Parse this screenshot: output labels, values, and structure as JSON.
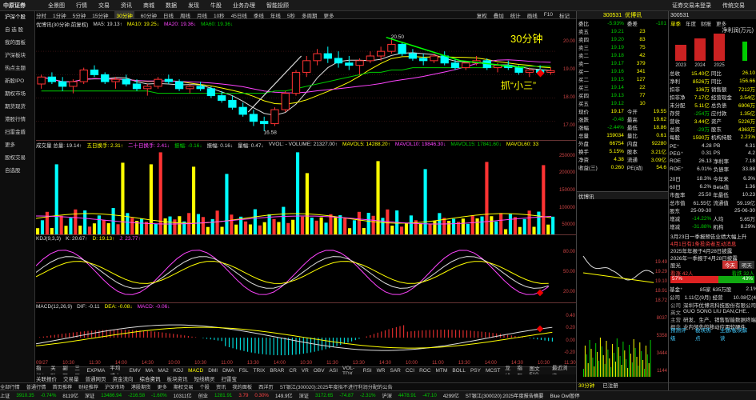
{
  "app": {
    "logo": "中原证券",
    "menu": [
      "全景图",
      "行情",
      "交易",
      "资讯",
      "商城",
      "数据",
      "发现",
      "牛股",
      "业务办理",
      "智能投顾"
    ],
    "right_menu": [
      "证券交易未登录",
      "传统交易"
    ]
  },
  "sidebar": [
    {
      "label": "沪深个股"
    },
    {
      "label": "自 选 股"
    },
    {
      "label": "我的面板"
    },
    {
      "label": "沪深板块"
    },
    {
      "label": "热点主题"
    },
    {
      "label": "新股IPO"
    },
    {
      "label": "期权市场"
    },
    {
      "label": "期货现货"
    },
    {
      "label": "港股行情"
    },
    {
      "label": "扫雷金盾"
    },
    {
      "label": "更多"
    },
    {
      "label": "股权交易"
    },
    {
      "label": "自选股"
    }
  ],
  "period_bar": {
    "items": [
      "分时",
      "1分钟",
      "5分钟",
      "15分钟",
      "30分钟",
      "60分钟",
      "日线",
      "周线",
      "月线",
      "10秒",
      "45日线",
      "季线",
      "年线",
      "5秒",
      "多周期",
      "更多"
    ],
    "selected": "30分钟",
    "right": [
      "复权",
      "叠加",
      "统计",
      "画线",
      "F10",
      "标记"
    ]
  },
  "main": {
    "title": "优博讯(30分钟,前复权)",
    "ma": [
      {
        "label": "MA5: 19.13↑",
        "color": "#ddd"
      },
      {
        "label": "MA10: 19.25↓",
        "color": "#ff0"
      },
      {
        "label": "MA20: 19.36↓",
        "color": "#f4f"
      },
      {
        "label": "MA60: 19.36↓",
        "color": "#0c0"
      }
    ],
    "annot1": "30分钟",
    "annot2": "抓“小三”",
    "high_label": "20.50",
    "low_label": "16.58",
    "y_ticks": [
      "20.00",
      "19.00",
      "18.00",
      "17.00"
    ]
  },
  "vol": {
    "legend": [
      {
        "label": "成交量 总量: 19.14↑",
        "color": "#ddd"
      },
      {
        "label": "五日换手: 2.31↑",
        "color": "#ff0"
      },
      {
        "label": "二十日换手: 2.41↓",
        "color": "#f4f"
      },
      {
        "label": "振幅: -0.16↓",
        "color": "#0c0"
      },
      {
        "label": "振幅: 0.16↓",
        "color": "#ddd"
      },
      {
        "label": "量幅: 0.47↓",
        "color": "#ddd"
      },
      {
        "label": "VVOL: - VOLUME: 21327.00↑",
        "color": "#ddd"
      },
      {
        "label": "MAVOL5: 14288.20↑",
        "color": "#ff0"
      },
      {
        "label": "MAVOL10: 19846.30↓",
        "color": "#f4f"
      },
      {
        "label": "MAVOL15: 17841.60↓",
        "color": "#0c0"
      },
      {
        "label": "MAVOL60: 33",
        "color": "#ff0"
      }
    ],
    "y_ticks": [
      "250000",
      "200000",
      "150000",
      "100000",
      "50000"
    ]
  },
  "kdj": {
    "legend": [
      {
        "label": "KDJ(9,3,3)",
        "color": "#ddd"
      },
      {
        "label": "K: 20.67↑",
        "color": "#ddd"
      },
      {
        "label": "D: 19.13↑",
        "color": "#ff0"
      },
      {
        "label": "J: 23.77↑",
        "color": "#f4f"
      }
    ],
    "y_ticks": [
      "80.00",
      "50.00",
      "20.00"
    ]
  },
  "macd": {
    "legend": [
      {
        "label": "MACD(12,26,9)",
        "color": "#ddd"
      },
      {
        "label": "DIF: -0.11",
        "color": "#ddd"
      },
      {
        "label": "DEA: -0.08↓",
        "color": "#ff0"
      },
      {
        "label": "MACD: -0.06↓",
        "color": "#f4f"
      }
    ],
    "y_ticks": [
      "0.40",
      "0.20",
      "0.00",
      "-0.20"
    ]
  },
  "time_axis": [
    "09/27",
    "10:30",
    "11:30",
    "14:00",
    "14:30",
    "10:00",
    "10:30",
    "11:00",
    "13:30",
    "14:00",
    "10:30",
    "11:30",
    "13:30",
    "14:30",
    "10:00",
    "11:00",
    "13:30",
    "14:00",
    "14:30",
    "10:30",
    "11:30"
  ],
  "indicator_bar": {
    "items": [
      "指标A",
      "关联",
      "副图",
      "三画",
      "EXPMA",
      "平均成本",
      "EMV",
      "MA",
      "MA2",
      "KDJ",
      "MACD",
      "DMI",
      "DMA",
      "FSL",
      "TRIX",
      "BRAR",
      "CR",
      "VR",
      "OBV",
      "ASI",
      "VOL-TDX",
      "RSI",
      "WR",
      "SAR",
      "CCI",
      "ROC",
      "MTM",
      "BOLL",
      "PSY",
      "MCST",
      "龙线",
      "指题"
    ],
    "selected": "MACD",
    "right": [
      "图文F10",
      "最近浏览"
    ]
  },
  "quote": {
    "code": "300531",
    "name": "优博讯",
    "webi": {
      "label": "委比",
      "val": "-5.93%",
      "label2": "委差",
      "val2": "-101"
    },
    "sell": [
      {
        "l": "卖五",
        "p": "19.21",
        "v": "23"
      },
      {
        "l": "卖四",
        "p": "19.20",
        "v": "83"
      },
      {
        "l": "卖三",
        "p": "19.19",
        "v": "75"
      },
      {
        "l": "卖二",
        "p": "19.18",
        "v": "42"
      },
      {
        "l": "卖一",
        "p": "19.17",
        "v": "379"
      }
    ],
    "buy": [
      {
        "l": "买一",
        "p": "19.16",
        "v": "341"
      },
      {
        "l": "买二",
        "p": "19.15",
        "v": "127"
      },
      {
        "l": "买三",
        "p": "19.14",
        "v": "22"
      },
      {
        "l": "买四",
        "p": "19.13",
        "v": "77"
      },
      {
        "l": "买五",
        "p": "19.12",
        "v": "10"
      }
    ],
    "stats": [
      [
        "现价",
        "19.17",
        "今开",
        "19.55"
      ],
      [
        "涨跌",
        "-0.48",
        "最高",
        "19.62"
      ],
      [
        "涨幅",
        "-2.44%",
        "最低",
        "18.86"
      ],
      [
        "总量",
        "159034",
        "量比",
        "0.61"
      ],
      [
        "外盘",
        "66754",
        "内盘",
        "92280"
      ],
      [
        "换手",
        "5.15%",
        "股本",
        "3.21亿"
      ],
      [
        "净资",
        "4.38",
        "流通",
        "3.09亿"
      ],
      [
        "收益(三)",
        "0.260",
        "PE(动)",
        "54.6"
      ]
    ]
  },
  "bottom_tabs": [
    "关联报价",
    "交易量",
    "普通网页",
    "资金流向",
    "综合资讯",
    "板块资讯",
    "短线精灵",
    "扫雷宝"
  ],
  "mini_chart": {
    "title": "优博讯",
    "y_ticks": [
      "22000",
      "18000",
      "14000",
      "10000",
      "6000"
    ],
    "axis": [
      "19.49",
      "19.29",
      "19.10",
      "18.91",
      "18.72"
    ],
    "bottom_ticks": [
      "8037",
      "5358",
      "3444",
      "1144"
    ],
    "bottom_label": "30分钟",
    "bottom_label2": "已注册"
  },
  "rp": {
    "code": "300531",
    "tabs": [
      "单季",
      "年度",
      "财报",
      "更多"
    ],
    "bars_title": "净利润(万元)",
    "bar_years": [
      "2023",
      "2024",
      "2025"
    ],
    "top_vals": [
      "19.17",
      "26.10",
      "20.00"
    ],
    "fin": [
      [
        "总收",
        "15.40亿",
        "同比",
        "26.10"
      ],
      [
        "净利",
        "8526万",
        "同比",
        "156.66"
      ],
      [
        "扣非",
        "136万",
        "销售额",
        "7212万"
      ],
      [
        "扣非净",
        "7.17亿",
        "经营现金",
        "3.54亿"
      ],
      [
        "未分配",
        "5.11亿",
        "总负债",
        "6906万"
      ],
      [
        "存贷",
        "-254万",
        "应付款",
        "1.35亿"
      ],
      [
        "营收",
        "3.44亿",
        "资产",
        "5226万"
      ],
      [
        "总资",
        "-29万",
        "股东",
        "4363万"
      ],
      [
        "每股",
        "1590万",
        "机构持股",
        "2.21%"
      ]
    ],
    "metrics": [
      [
        "PE⁺",
        "4.28",
        "PB",
        "4.31"
      ],
      [
        "PEG⁺",
        "0.31",
        "PS",
        "4.2"
      ],
      [
        "ROE",
        "26.13",
        "净利率",
        "7.18"
      ],
      [
        "ROE⁺",
        "6.01%",
        "负债率",
        "33.88"
      ]
    ],
    "perf": [
      [
        "20日",
        "18.3%",
        "今年来",
        "6.3%"
      ],
      [
        "60日",
        "6.2%",
        "Beta值",
        "1.36"
      ],
      [
        "市盈率",
        "25.50",
        "年最低",
        "10.23"
      ],
      [
        "总市值",
        "61.55亿",
        "流通值",
        "59.19亿"
      ],
      [
        "股东",
        "25-09-30",
        "",
        "25-06-30"
      ],
      [
        "增减",
        "-14.22%",
        "人均",
        "5.65万"
      ],
      [
        "增减",
        "-31.88%",
        "机构",
        "8.29%"
      ]
    ],
    "news": [
      "3月23日一季报预告业绩大幅上升",
      "4月1日有1条投资者互动消息",
      "2025年年报于4月28日披露",
      "2026年一季报于4月28日披露"
    ],
    "sentiment": {
      "label": "股光",
      "up": "57%",
      "down": "43%",
      "buy": "看涨 42人",
      "sell": "看跌 32人",
      "btn1": "今天",
      "btn2": "明天"
    },
    "funds": [
      [
        "基金⁺",
        "85家",
        "635万股",
        "2.1%"
      ],
      [
        "公司",
        "1.11亿(9月)",
        "经营",
        "10.08亿(4)"
      ]
    ],
    "company": [
      [
        "公司",
        "深圳市优博讯科技股份有限公司"
      ],
      [
        "英文",
        "GUO SONG LIU DAN,CHE.."
      ],
      [
        "主营",
        "研发、生产、销售智能数据终端"
      ],
      [
        "概念",
        "业内领先的移动应用软硬件"
      ]
    ],
    "links": [
      "预测评级",
      "板块热点",
      "主题/板块解读"
    ]
  },
  "status": [
    {
      "t": "上证",
      "c": "#ddd"
    },
    {
      "t": "3910.35",
      "c": "#0c0"
    },
    {
      "t": "-0.74%",
      "c": "#0c0"
    },
    {
      "t": "8119亿",
      "c": "#ddd"
    },
    {
      "t": "深证",
      "c": "#ddd"
    },
    {
      "t": "13486.94",
      "c": "#0c0"
    },
    {
      "t": "-216.58",
      "c": "#0c0"
    },
    {
      "t": "-1.60%",
      "c": "#0c0"
    },
    {
      "t": "10311亿",
      "c": "#ddd"
    },
    {
      "t": "创业",
      "c": "#ddd"
    },
    {
      "t": "1281.91",
      "c": "#0c0"
    },
    {
      "t": "3.79",
      "c": "#f44"
    },
    {
      "t": "0.30%",
      "c": "#f44"
    },
    {
      "t": "149.9亿",
      "c": "#ddd"
    },
    {
      "t": "深证",
      "c": "#ddd"
    },
    {
      "t": "3172.65",
      "c": "#0c0"
    },
    {
      "t": "-74.87",
      "c": "#0c0"
    },
    {
      "t": "-2.31%",
      "c": "#0c0"
    },
    {
      "t": "沪深",
      "c": "#ddd"
    },
    {
      "t": "4478.91",
      "c": "#0c0"
    },
    {
      "t": "-47.10",
      "c": "#0c0"
    },
    {
      "t": "4299亿",
      "c": "#ddd"
    },
    {
      "t": "ST银江(300020):2025年度报告摘要",
      "c": "#ddd"
    },
    {
      "t": "Blue Owl暂停",
      "c": "#ddd"
    }
  ],
  "ticker": [
    "全部行情",
    "普通行情",
    "首页推荐",
    "财经推荐",
    "沪深市场",
    "港股期货",
    "更多",
    "期权交易",
    "个股",
    "资讯",
    "我的面板",
    "西洋历",
    "ST银江(300020):2025年度拟不进行利润分配的公告"
  ],
  "chart_data": {
    "type": "candlestick",
    "title": "优博讯(30分钟,前复权)",
    "ylim": [
      16.2,
      21.0
    ],
    "candles": [
      [
        18.6,
        19.0,
        18.4,
        18.9
      ],
      [
        18.9,
        19.1,
        18.6,
        18.7
      ],
      [
        18.7,
        18.9,
        18.3,
        18.5
      ],
      [
        18.5,
        18.8,
        18.2,
        18.7
      ],
      [
        18.7,
        19.3,
        18.6,
        19.2
      ],
      [
        19.2,
        19.4,
        18.9,
        19.0
      ],
      [
        19.0,
        19.1,
        18.6,
        18.7
      ],
      [
        18.7,
        18.9,
        18.4,
        18.8
      ],
      [
        18.8,
        19.0,
        18.5,
        18.6
      ],
      [
        18.6,
        18.8,
        18.3,
        18.4
      ],
      [
        18.4,
        18.6,
        18.1,
        18.5
      ],
      [
        18.5,
        18.9,
        18.4,
        18.8
      ],
      [
        18.8,
        19.0,
        18.6,
        18.7
      ],
      [
        18.7,
        18.8,
        18.3,
        18.4
      ],
      [
        18.4,
        18.6,
        18.2,
        18.5
      ],
      [
        18.5,
        18.7,
        18.3,
        18.4
      ],
      [
        18.4,
        18.5,
        18.0,
        18.1
      ],
      [
        18.1,
        18.3,
        17.8,
        17.9
      ],
      [
        17.9,
        18.1,
        17.5,
        17.6
      ],
      [
        17.6,
        17.8,
        17.2,
        17.3
      ],
      [
        17.3,
        17.5,
        16.8,
        17.0
      ],
      [
        17.0,
        17.2,
        16.58,
        16.9
      ],
      [
        16.9,
        17.6,
        16.8,
        17.5
      ],
      [
        17.5,
        18.3,
        17.4,
        18.2
      ],
      [
        18.2,
        19.2,
        18.1,
        19.1
      ],
      [
        19.1,
        19.8,
        18.9,
        19.6
      ],
      [
        19.6,
        20.1,
        19.4,
        19.9
      ],
      [
        19.9,
        20.2,
        19.5,
        19.7
      ],
      [
        19.7,
        20.0,
        19.3,
        19.5
      ],
      [
        19.5,
        19.8,
        19.2,
        19.4
      ],
      [
        19.4,
        19.7,
        19.0,
        19.6
      ],
      [
        19.6,
        20.0,
        19.5,
        19.8
      ],
      [
        19.8,
        20.2,
        19.6,
        20.0
      ],
      [
        20.0,
        20.5,
        19.9,
        20.3
      ],
      [
        20.3,
        20.4,
        19.8,
        19.9
      ],
      [
        19.9,
        20.1,
        19.6,
        19.7
      ],
      [
        19.7,
        19.9,
        19.4,
        19.6
      ],
      [
        19.6,
        19.9,
        19.5,
        19.8
      ],
      [
        19.8,
        20.0,
        19.4,
        19.5
      ],
      [
        19.5,
        19.7,
        19.2,
        19.3
      ],
      [
        19.3,
        19.6,
        19.2,
        19.5
      ],
      [
        19.5,
        19.8,
        19.4,
        19.6
      ],
      [
        19.6,
        19.7,
        19.2,
        19.3
      ],
      [
        19.3,
        19.5,
        19.1,
        19.4
      ],
      [
        19.4,
        19.6,
        19.2,
        19.3
      ],
      [
        19.3,
        19.4,
        19.0,
        19.1
      ],
      [
        19.1,
        19.3,
        18.9,
        19.2
      ],
      [
        19.2,
        19.4,
        19.0,
        19.1
      ],
      [
        19.1,
        19.3,
        19.0,
        19.17
      ]
    ],
    "ma60": [
      18.3,
      18.3,
      18.3,
      18.3,
      18.3,
      18.3,
      18.3,
      18.3,
      18.3,
      18.3,
      18.3,
      18.2,
      18.2,
      18.2,
      18.2,
      18.2,
      18.2,
      18.2,
      18.2,
      18.2,
      18.2,
      18.2,
      18.3,
      18.3,
      18.4,
      18.5,
      18.6,
      18.7,
      18.8,
      18.9,
      19.0,
      19.1,
      19.1,
      19.2,
      19.2,
      19.3,
      19.3,
      19.3,
      19.3,
      19.3,
      19.3,
      19.3,
      19.3,
      19.35,
      19.35,
      19.35,
      19.36,
      19.36,
      19.36
    ]
  }
}
